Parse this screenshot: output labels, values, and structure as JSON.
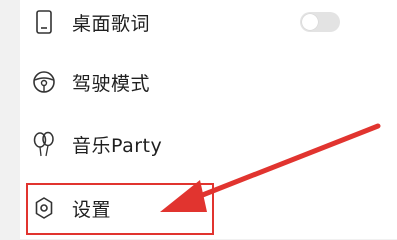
{
  "menu": {
    "items": [
      {
        "label": "桌面歌词",
        "icon": "phone-lyrics-icon",
        "toggle": "off"
      },
      {
        "label": "驾驶模式",
        "icon": "steering-wheel-icon"
      },
      {
        "label": "音乐Party",
        "icon": "balloon-icon"
      },
      {
        "label": "设置",
        "icon": "gear-icon"
      }
    ]
  },
  "highlight_color": "#e1342f"
}
